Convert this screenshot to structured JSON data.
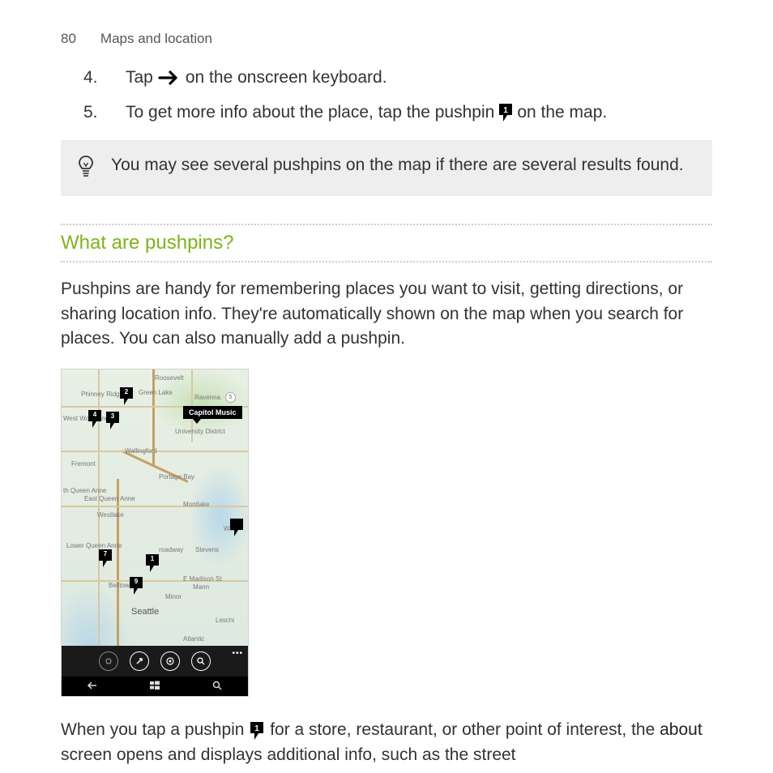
{
  "header": {
    "page_number": "80",
    "section": "Maps and location"
  },
  "steps": [
    {
      "number": "4.",
      "text_before": "Tap",
      "text_after": "on the onscreen keyboard."
    },
    {
      "number": "5.",
      "text_before": "To get more info about the place, tap the pushpin",
      "text_after": "on the map."
    }
  ],
  "tip": {
    "text": "You may see several pushpins on the map if there are several results found."
  },
  "heading": "What are pushpins?",
  "intro_paragraph": "Pushpins are handy for remembering places you want to visit, getting directions, or sharing location info. They're automatically shown on the map when you search for places. You can also manually add a pushpin.",
  "map": {
    "callout": "Capitol Music",
    "labels": {
      "roosevelt": "Roosevelt",
      "phinney": "Phinney Ridge",
      "greenlake": "Green Lake",
      "ravenna": "Ravenna",
      "westwoodland": "West Woodland",
      "udist": "University District",
      "wallingford": "Wallingford",
      "fremont": "Fremont",
      "portage": "Portage Bay",
      "nqueen": "th Queen Anne",
      "equeen": "East Queen Anne",
      "westlake": "Westlake",
      "montlake": "Montlake",
      "was": "Was",
      "lqueen": "Lower Queen Anne",
      "broadway": "roadway",
      "stevens": "Stevens",
      "mann": "Mann",
      "madison": "E Madison St",
      "minor": "Minor",
      "belltown": "Belltown",
      "seattle": "Seattle",
      "leschi": "Leschi",
      "atlantic": "Atlantic"
    },
    "pins": [
      "2",
      "3",
      "4",
      "7",
      "1",
      "9",
      ""
    ],
    "hwy_5": "5"
  },
  "bottom": {
    "text_before": "When you tap a pushpin",
    "text_mid": "for a store, restaurant, or other point of interest, the",
    "bold_word": "about",
    "text_after": "screen opens and displays additional info, such as the street"
  }
}
